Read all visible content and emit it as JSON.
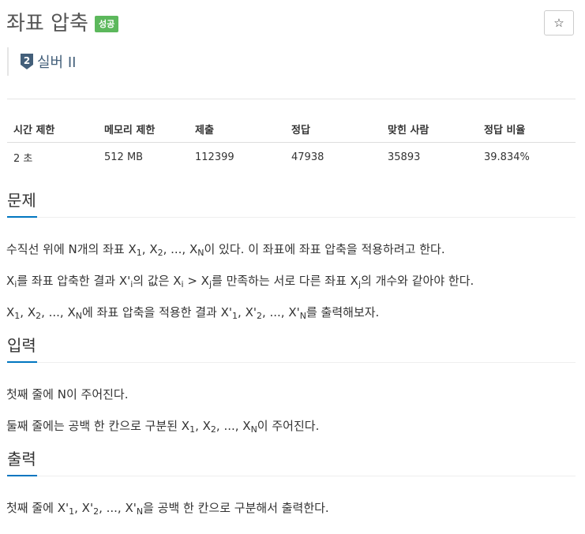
{
  "problem": {
    "title": "좌표 압축",
    "status_badge": "성공",
    "star_icon": "star-icon",
    "tier": {
      "icon": "silver-2-icon",
      "icon_number": "2",
      "label": "실버 II"
    }
  },
  "info_table": {
    "headers": [
      "시간 제한",
      "메모리 제한",
      "제출",
      "정답",
      "맞힌 사람",
      "정답 비율"
    ],
    "values": [
      "2 초",
      "512 MB",
      "112399",
      "47938",
      "35893",
      "39.834%"
    ]
  },
  "sections": {
    "description": {
      "title": "문제",
      "p1": {
        "a": "수직선 위에 N개의 좌표 X",
        "s1": "1",
        "b": ", X",
        "s2": "2",
        "c": ", ..., X",
        "s3": "N",
        "d": "이 있다. 이 좌표에 좌표 압축을 적용하려고 한다."
      },
      "p2": {
        "a": "X",
        "s1": "i",
        "b": "를 좌표 압축한 결과 X'",
        "s2": "i",
        "c": "의 값은 X",
        "s3": "i",
        "d": " > X",
        "s4": "j",
        "e": "를 만족하는 서로 다른 좌표 X",
        "s5": "j",
        "f": "의 개수와 같아야 한다."
      },
      "p3": {
        "a": "X",
        "s1": "1",
        "b": ", X",
        "s2": "2",
        "c": ", ..., X",
        "s3": "N",
        "d": "에 좌표 압축을 적용한 결과 X'",
        "s4": "1",
        "e": ", X'",
        "s5": "2",
        "f": ", ..., X'",
        "s6": "N",
        "g": "를 출력해보자."
      }
    },
    "input": {
      "title": "입력",
      "p1": "첫째 줄에 N이 주어진다.",
      "p2": {
        "a": "둘째 줄에는 공백 한 칸으로 구분된 X",
        "s1": "1",
        "b": ", X",
        "s2": "2",
        "c": ", ..., X",
        "s3": "N",
        "d": "이 주어진다."
      }
    },
    "output": {
      "title": "출력",
      "p1": {
        "a": "첫째 줄에 X'",
        "s1": "1",
        "b": ", X'",
        "s2": "2",
        "c": ", ..., X'",
        "s3": "N",
        "d": "을 공백 한 칸으로 구분해서 출력한다."
      }
    }
  },
  "colors": {
    "badge": "#5cb85c",
    "tier": "#435f7a",
    "section_underline": "#0076c0"
  }
}
